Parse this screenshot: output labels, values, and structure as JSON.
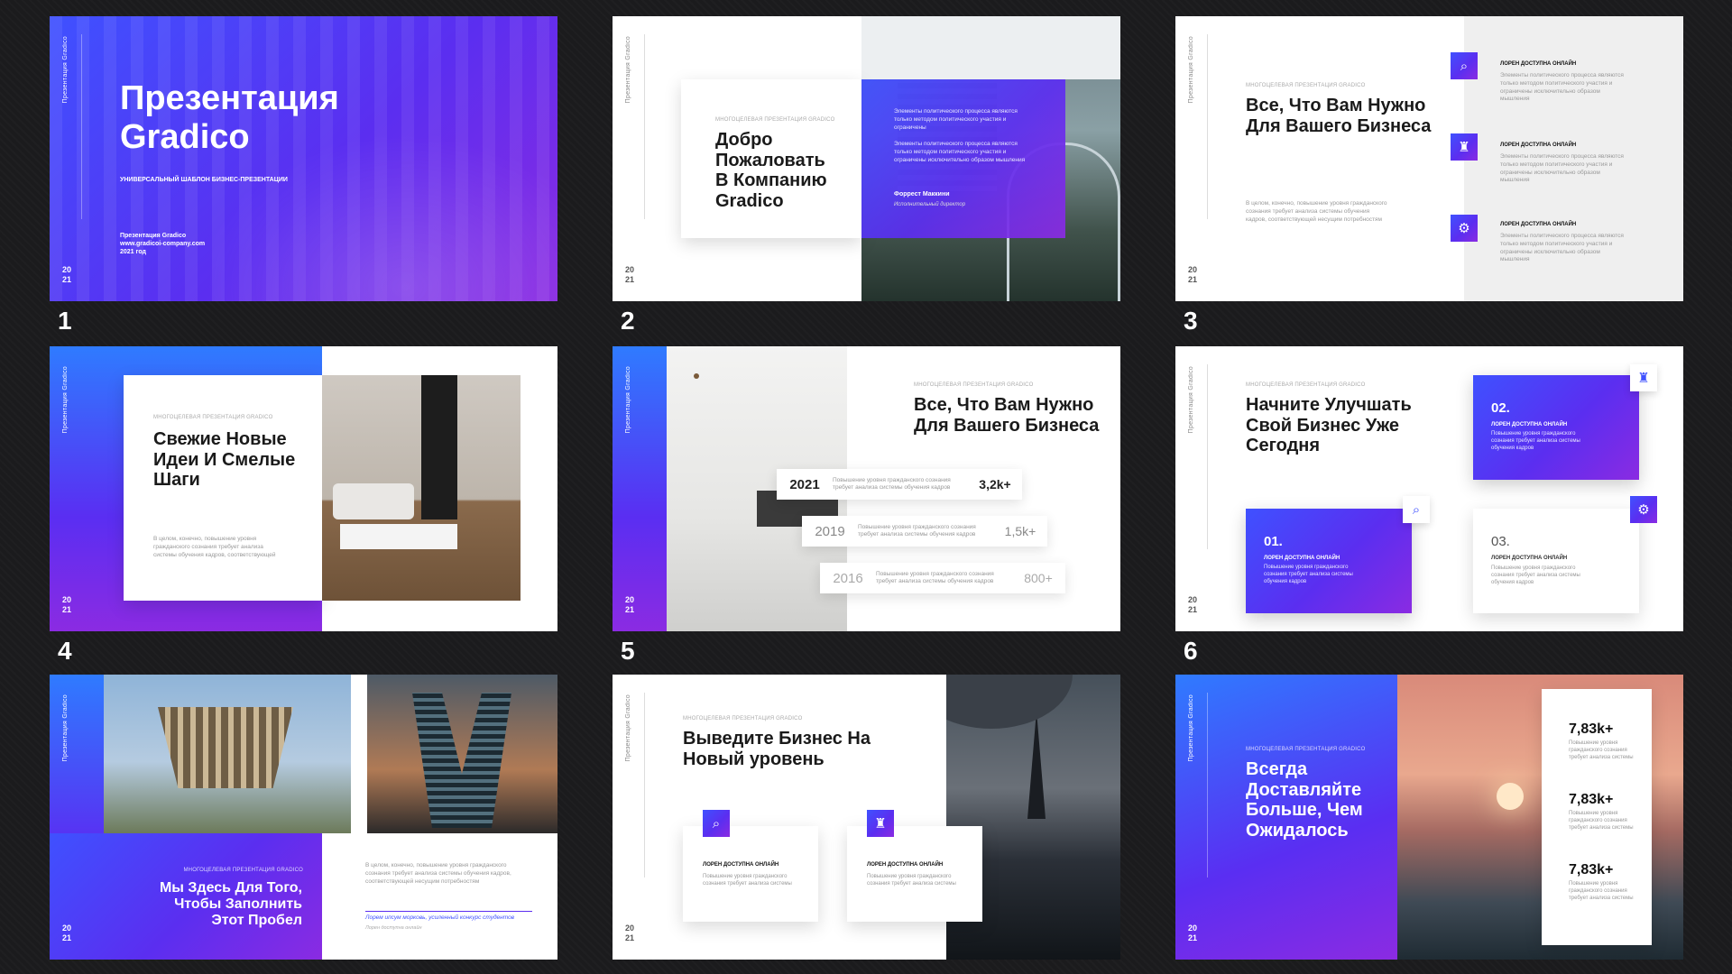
{
  "slide_numbers": [
    "1",
    "2",
    "3",
    "4",
    "5",
    "6",
    "7",
    "8",
    "9"
  ],
  "common": {
    "vertical_tag": "Презентация Gradico",
    "year_top": "20",
    "year_bottom": "21",
    "kicker": "МНОГОЦЕЛЕВАЯ ПРЕЗЕНТАЦИЯ GRADICO"
  },
  "s1": {
    "title": "Презентация Gradico",
    "subtitle": "УНИВЕРСАЛЬНЫЙ ШАБЛОН БИЗНЕС-ПРЕЗЕНТАЦИИ",
    "footer_1": "Презентация Gradico",
    "footer_2": "www.gradicoi-company.com",
    "footer_3": "2021 год"
  },
  "s2": {
    "title": "Добро Пожаловать В Компанию Gradico",
    "p1": "Элементы политического процесса являются только методом политического участия и ограничены",
    "p2": "Элементы политического процесса являются только методом политического участия и ограничены исключительно образом мышления",
    "name": "Форрест Маккини",
    "role": "Исполнительный директор"
  },
  "s3": {
    "title": "Все, Что Вам Нужно Для Вашего Бизнеса",
    "body": "В целом, конечно, повышение уровня гражданского сознания требует анализа системы обучения кадров, соответствующей несущим потребностям",
    "items": [
      {
        "head": "ЛОРЕН ДОСТУПНА ОНЛАЙН",
        "text": "Элементы политического процесса являются только методом политического участия и ограничены исключительно образом мышления"
      },
      {
        "head": "ЛОРЕН ДОСТУПНА ОНЛАЙН",
        "text": "Элементы политического процесса являются только методом политического участия и ограничены исключительно образом мышления"
      },
      {
        "head": "ЛОРЕН ДОСТУПНА ОНЛАЙН",
        "text": "Элементы политического процесса являются только методом политического участия и ограничены исключительно образом мышления"
      }
    ]
  },
  "s4": {
    "title": "Свежие Новые Идеи И Смелые Шаги",
    "body": "В целом, конечно, повышение уровня гражданского сознания требует анализа системы обучения кадров, соответствующей"
  },
  "s5": {
    "title": "Все, Что Вам Нужно Для Вашего Бизнеса",
    "stats": [
      {
        "year": "2021",
        "desc": "Повышение уровня гражданского сознания требует анализа системы обучения кадров",
        "value": "3,2k+"
      },
      {
        "year": "2019",
        "desc": "Повышение уровня гражданского сознания требует анализа системы обучения кадров",
        "value": "1,5k+"
      },
      {
        "year": "2016",
        "desc": "Повышение уровня гражданского сознания требует анализа системы обучения кадров",
        "value": "800+"
      }
    ]
  },
  "s6": {
    "title": "Начните Улучшать Свой Бизнес Уже Сегодня",
    "cards": [
      {
        "num": "01.",
        "head": "ЛОРЕН ДОСТУПНА ОНЛАЙН",
        "text": "Повышение уровня гражданского сознания требует анализа системы обучения кадров"
      },
      {
        "num": "02.",
        "head": "ЛОРЕН ДОСТУПНА ОНЛАЙН",
        "text": "Повышение уровня гражданского сознания требует анализа системы обучения кадров"
      },
      {
        "num": "03.",
        "head": "ЛОРЕН ДОСТУПНА ОНЛАЙН",
        "text": "Повышение уровня гражданского сознания требует анализа системы обучения кадров"
      }
    ]
  },
  "s7": {
    "title": "Мы Здесь Для Того, Чтобы Заполнить Этот Пробел",
    "body": "В целом, конечно, повышение уровня гражданского сознания требует анализа системы обучения кадров, соответствующей несущим потребностям",
    "quote": "Лорем ипсум морковь, усиленный конкурс студентов",
    "quote_sub": "Лорен доступна онлайн"
  },
  "s8": {
    "title": "Выведите Бизнес На Новый уровень",
    "cards": [
      {
        "head": "ЛОРЕН ДОСТУПНА ОНЛАЙН",
        "text": "Повышение уровня гражданского сознания требует анализа системы"
      },
      {
        "head": "ЛОРЕН ДОСТУПНА ОНЛАЙН",
        "text": "Повышение уровня гражданского сознания требует анализа системы"
      }
    ]
  },
  "s9": {
    "title": "Всегда Доставляйте Больше, Чем Ожидалось",
    "stats": [
      {
        "value": "7,83k+",
        "text": "Повышение уровня гражданского сознания требует анализа системы"
      },
      {
        "value": "7,83k+",
        "text": "Повышение уровня гражданского сознания требует анализа системы"
      },
      {
        "value": "7,83k+",
        "text": "Повышение уровня гражданского сознания требует анализа системы"
      }
    ]
  },
  "icons": {
    "search": "search-icon",
    "chess": "chess-icon",
    "gear": "gear-icon",
    "chart": "chart-search-icon"
  },
  "colors": {
    "blue": "#3f51ff",
    "violet": "#5b2ef0",
    "purple": "#8a2be2",
    "accent_blue": "#2f7bff"
  }
}
